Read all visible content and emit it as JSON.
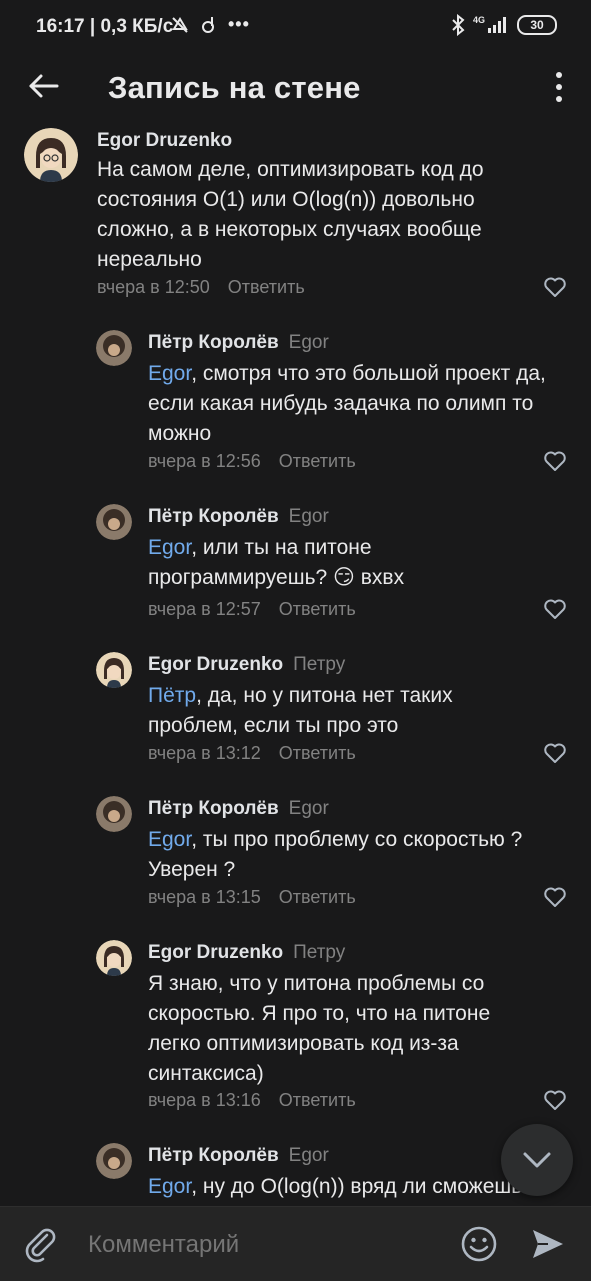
{
  "status_bar": {
    "time_info": "16:17 | 0,3 КБ/с",
    "network": "4G",
    "battery": "30"
  },
  "header": {
    "title": "Запись на стене"
  },
  "comments": [
    {
      "author": "Egor Druzenko",
      "reply_to": "",
      "mention": "",
      "text": "На самом деле, оптимизировать код до состояния O(1) или O(log(n)) довольно сложно, а в некоторых случаях вообще нереально",
      "time": "вчера в 12:50",
      "reply_label": "Ответить"
    },
    {
      "author": "Пётр Королёв",
      "reply_to": "Egor",
      "mention": "Egor",
      "text": ", смотря что это большой проект да, если какая нибудь задачка по олимп то можно",
      "time": "вчера в 12:56",
      "reply_label": "Ответить"
    },
    {
      "author": "Пётр Королёв",
      "reply_to": "Egor",
      "mention": "Egor",
      "text": ", или ты на питоне программируешь? 😏 вхвх",
      "time": "вчера в 12:57",
      "reply_label": "Ответить"
    },
    {
      "author": "Egor Druzenko",
      "reply_to": "Петру",
      "mention": "Пётр",
      "text": ", да, но у питона нет таких проблем, если ты про это",
      "time": "вчера в 13:12",
      "reply_label": "Ответить"
    },
    {
      "author": "Пётр Королёв",
      "reply_to": "Egor",
      "mention": "Egor",
      "text": ", ты про проблему со скоростью ? Уверен ?",
      "time": "вчера в 13:15",
      "reply_label": "Ответить"
    },
    {
      "author": "Egor Druzenko",
      "reply_to": "Петру",
      "mention": "",
      "text": "Я знаю, что у питона проблемы со скоростью. Я про то, что на питоне легко оптимизировать код из-за синтаксиса)",
      "time": "вчера в 13:16",
      "reply_label": "Ответить"
    },
    {
      "author": "Пётр Королёв",
      "reply_to": "Egor",
      "mention": "Egor",
      "text": ", ну до O(log(n)) вряд ли сможешь",
      "time": "",
      "reply_label": ""
    }
  ],
  "composer": {
    "placeholder": "Комментарий"
  },
  "icons": {
    "back": "arrow-left-icon",
    "menu": "more-vertical-icon",
    "like": "heart-outline-icon",
    "scroll_down": "chevron-down-icon",
    "attach": "paperclip-icon",
    "emoji": "smile-icon",
    "send": "send-icon"
  },
  "colors": {
    "background": "#19191a",
    "mention": "#71aaeb",
    "secondary_text": "#828282"
  }
}
